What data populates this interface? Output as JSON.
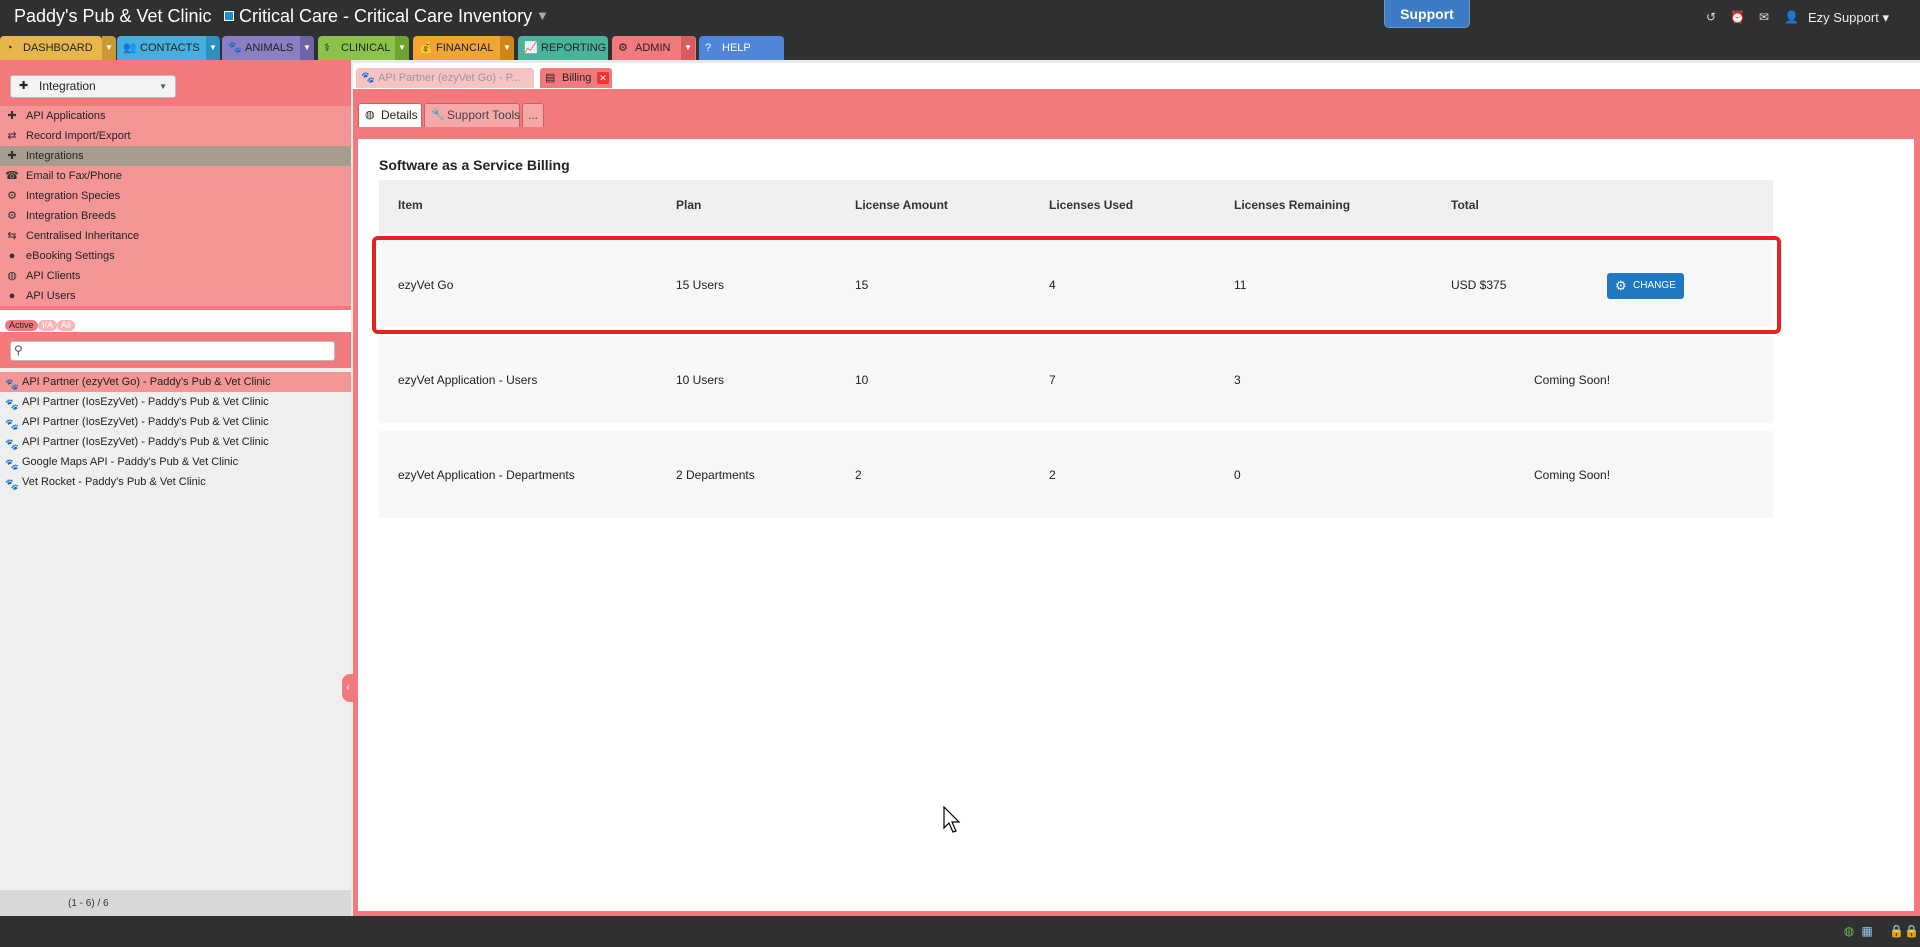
{
  "header": {
    "clinic_name": "Paddy's Pub & Vet Clinic",
    "department": "Critical Care  - Critical Care Inventory",
    "support_label": "Support",
    "user_name": "Ezy Support"
  },
  "nav": {
    "items": [
      {
        "label": "DASHBOARD",
        "color": "#e6b84c"
      },
      {
        "label": "CONTACTS",
        "color": "#47aee0"
      },
      {
        "label": "ANIMALS",
        "color": "#8b7ec2"
      },
      {
        "label": "CLINICAL",
        "color": "#8bc34a"
      },
      {
        "label": "FINANCIAL",
        "color": "#f0a534"
      },
      {
        "label": "REPORTING",
        "color": "#49b39b"
      },
      {
        "label": "ADMIN",
        "color": "#f37a7c"
      },
      {
        "label": "HELP",
        "color": "#4f86d9"
      }
    ]
  },
  "sidebar": {
    "module": "Integration",
    "links": [
      "API Applications",
      "Record Import/Export",
      "Integrations",
      "Email to Fax/Phone",
      "Integration Species",
      "Integration Breeds",
      "Centralised Inheritance",
      "eBooking Settings",
      "API Clients",
      "API Users"
    ],
    "active_link": "Integrations",
    "filters": [
      "Active",
      "I/A",
      "All"
    ],
    "search_placeholder": "",
    "records": [
      "API Partner (ezyVet Go) - Paddy's Pub & Vet Clinic",
      "API Partner (IosEzyVet) - Paddy's Pub & Vet Clinic",
      "API Partner (IosEzyVet) - Paddy's Pub & Vet Clinic",
      "API Partner (IosEzyVet) - Paddy's Pub & Vet Clinic",
      "Google Maps API - Paddy's Pub & Vet Clinic",
      "Vet Rocket - Paddy's Pub & Vet Clinic"
    ],
    "record_count": "(1 - 6) / 6"
  },
  "doc_tabs": [
    {
      "label": "API Partner (ezyVet Go) - P..."
    },
    {
      "label": "Billing"
    }
  ],
  "sub_tabs": [
    {
      "label": "Details"
    },
    {
      "label": "Support Tools"
    },
    {
      "label": "..."
    }
  ],
  "billing": {
    "title": "Software as a Service Billing",
    "columns": [
      "Item",
      "Plan",
      "License Amount",
      "Licenses Used",
      "Licenses Remaining",
      "Total"
    ],
    "rows": [
      {
        "item": "ezyVet Go",
        "plan": "15 Users",
        "amount": "15",
        "used": "4",
        "remaining": "11",
        "total": "USD $375",
        "action": "CHANGE"
      },
      {
        "item": "ezyVet Application - Users",
        "plan": "10 Users",
        "amount": "10",
        "used": "7",
        "remaining": "3",
        "total": "",
        "action": "Coming Soon!"
      },
      {
        "item": "ezyVet Application - Departments",
        "plan": "2 Departments",
        "amount": "2",
        "used": "2",
        "remaining": "0",
        "total": "",
        "action": "Coming Soon!"
      }
    ]
  }
}
